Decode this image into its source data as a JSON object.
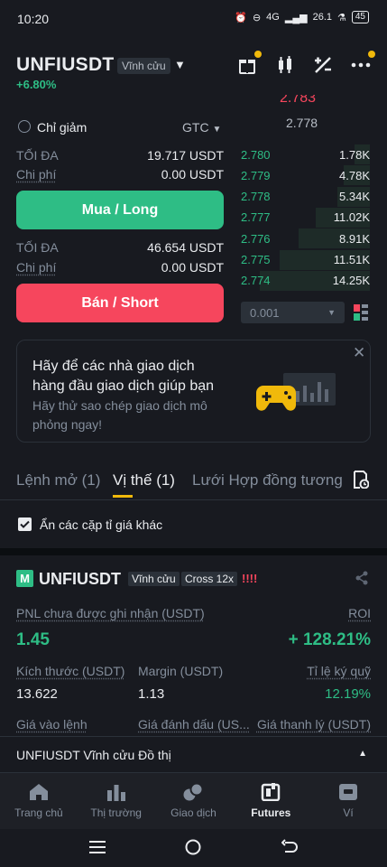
{
  "status_bar": {
    "time": "10:20",
    "network": "4G",
    "speed": "26.1",
    "battery": "45"
  },
  "header": {
    "symbol": "UNFIUSDT",
    "contract_type": "Vĩnh cửu",
    "change": "+6.80%"
  },
  "order_form": {
    "reduce_only_label": "Chỉ giảm",
    "tif": "GTC",
    "buy": {
      "max_label": "TỐI ĐA",
      "max_value": "19.717 USDT",
      "cost_label": "Chi phí",
      "cost_value": "0.00 USDT",
      "button": "Mua / Long"
    },
    "sell": {
      "max_label": "TỐI ĐA",
      "max_value": "46.654 USDT",
      "cost_label": "Chi phí",
      "cost_value": "0.00 USDT",
      "button": "Bán / Short"
    }
  },
  "orderbook": {
    "cut_price": "2.783",
    "mark_price": "2.778",
    "bids": [
      {
        "price": "2.780",
        "qty": "1.78K",
        "depth": 0.12
      },
      {
        "price": "2.779",
        "qty": "4.78K",
        "depth": 0.2
      },
      {
        "price": "2.778",
        "qty": "5.34K",
        "depth": 0.25
      },
      {
        "price": "2.777",
        "qty": "11.02K",
        "depth": 0.42
      },
      {
        "price": "2.776",
        "qty": "8.91K",
        "depth": 0.55
      },
      {
        "price": "2.775",
        "qty": "11.51K",
        "depth": 0.7
      },
      {
        "price": "2.774",
        "qty": "14.25K",
        "depth": 0.85
      }
    ],
    "precision": "0.001"
  },
  "promo": {
    "title_line1": "Hãy để các nhà giao dịch",
    "title_line2": "hàng đầu giao dịch giúp bạn",
    "sub_line1": "Hãy thử sao chép giao dịch mô",
    "sub_line2": "phỏng ngay!"
  },
  "tabs": {
    "open_orders": "Lệnh mở (1)",
    "positions": "Vị thế (1)",
    "grid": "Lưới Hợp đồng tương l"
  },
  "hide_pairs_label": "Ẩn các cặp tỉ giá khác",
  "position": {
    "symbol": "UNFIUSDT",
    "type": "Vĩnh cửu",
    "margin_mode": "Cross 12x",
    "warn": "!!!!",
    "pnl_label": "PNL chưa được ghi nhận (USDT)",
    "pnl_value": "1.45",
    "roi_label": "ROI",
    "roi_value": "+ 128.21%",
    "size_label": "Kích thước (USDT)",
    "size_value": "13.622",
    "margin_label": "Margin (USDT)",
    "margin_value": "1.13",
    "margin_ratio_label": "Tỉ lệ ký quỹ",
    "margin_ratio_value": "12.19%",
    "entry_label": "Giá vào lệnh",
    "mark_label": "Giá đánh dấu (US...",
    "liq_label": "Giá thanh lý (USDT)"
  },
  "chart_bar": {
    "label": "UNFIUSDT Vĩnh cửu Đồ thị"
  },
  "nav": [
    {
      "label": "Trang chủ",
      "icon": "home-icon"
    },
    {
      "label": "Thị trường",
      "icon": "market-icon"
    },
    {
      "label": "Giao dịch",
      "icon": "trade-icon"
    },
    {
      "label": "Futures",
      "icon": "futures-icon"
    },
    {
      "label": "Ví",
      "icon": "wallet-icon"
    }
  ],
  "colors": {
    "green": "#2ebd85",
    "red": "#f6465d",
    "accent": "#f0b90b",
    "bg": "#181a20"
  }
}
